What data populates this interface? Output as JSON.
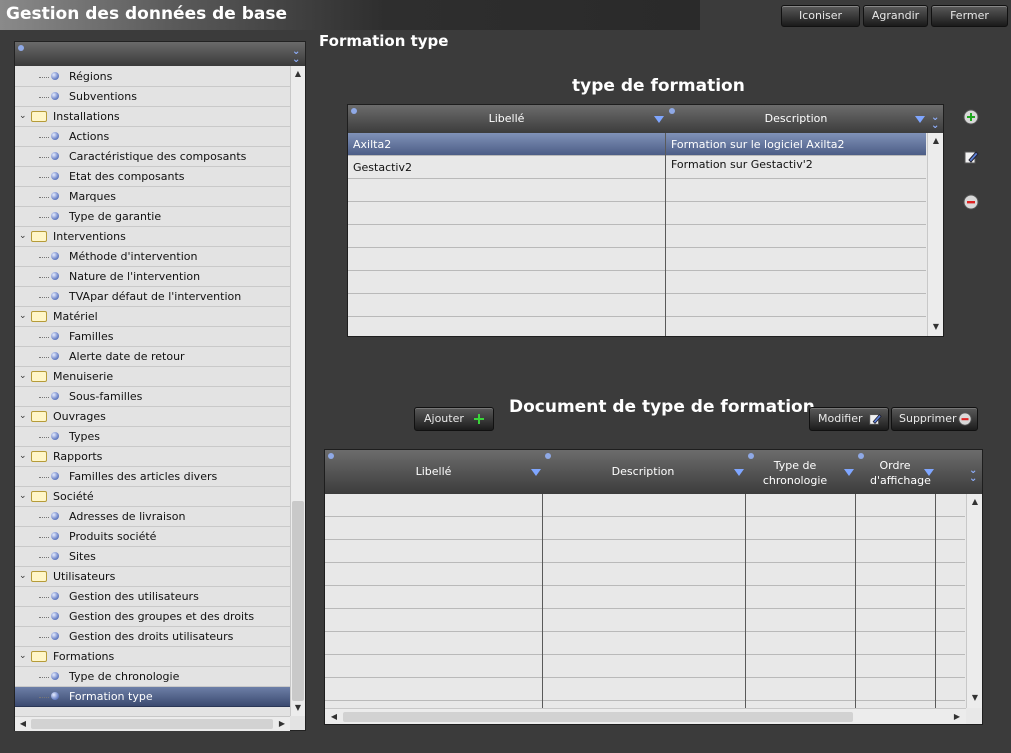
{
  "app": {
    "title": "Gestion des données de base"
  },
  "window_buttons": {
    "iconize": "Iconiser",
    "maximize": "Agrandir",
    "close": "Fermer"
  },
  "page": {
    "title": "Formation type"
  },
  "tree": [
    {
      "label": "Régions",
      "level": 1
    },
    {
      "label": "Subventions",
      "level": 1
    },
    {
      "label": "Installations",
      "level": 0
    },
    {
      "label": "Actions",
      "level": 1
    },
    {
      "label": "Caractéristique des composants",
      "level": 1
    },
    {
      "label": "Etat des composants",
      "level": 1
    },
    {
      "label": "Marques",
      "level": 1
    },
    {
      "label": "Type de garantie",
      "level": 1
    },
    {
      "label": "Interventions",
      "level": 0
    },
    {
      "label": "Méthode d'intervention",
      "level": 1
    },
    {
      "label": "Nature de l'intervention",
      "level": 1
    },
    {
      "label": "TVApar défaut de l'intervention",
      "level": 1
    },
    {
      "label": "Matériel",
      "level": 0
    },
    {
      "label": "Familles",
      "level": 1
    },
    {
      "label": "Alerte date de retour",
      "level": 1
    },
    {
      "label": "Menuiserie",
      "level": 0
    },
    {
      "label": "Sous-familles",
      "level": 1
    },
    {
      "label": "Ouvrages",
      "level": 0
    },
    {
      "label": "Types",
      "level": 1
    },
    {
      "label": "Rapports",
      "level": 0
    },
    {
      "label": "Familles des articles divers",
      "level": 1
    },
    {
      "label": "Société",
      "level": 0
    },
    {
      "label": "Adresses de livraison",
      "level": 1
    },
    {
      "label": "Produits société",
      "level": 1
    },
    {
      "label": "Sites",
      "level": 1
    },
    {
      "label": "Utilisateurs",
      "level": 0
    },
    {
      "label": "Gestion des utilisateurs",
      "level": 1
    },
    {
      "label": "Gestion des groupes et des droits",
      "level": 1
    },
    {
      "label": "Gestion des droits utilisateurs",
      "level": 1
    },
    {
      "label": "Formations",
      "level": 0
    },
    {
      "label": "Type de chronologie",
      "level": 1
    },
    {
      "label": "Formation type",
      "level": 1,
      "selected": true
    }
  ],
  "type_section": {
    "title": "type de formation",
    "columns": [
      "Libellé",
      "Description"
    ],
    "rows": [
      {
        "libelle": "Axilta2",
        "description": "Formation sur le logiciel Axilta2",
        "selected": true
      },
      {
        "libelle": "Gestactiv2",
        "description": "Formation sur Gestactiv'2"
      }
    ],
    "icons": [
      "add-icon",
      "edit-icon",
      "delete-icon"
    ]
  },
  "doc_section": {
    "title": "Document de type de formation",
    "add_label": "Ajouter",
    "modify_label": "Modifier",
    "delete_label": "Supprimer",
    "columns": [
      "Libellé",
      "Description",
      "Type de chronologie",
      "Ordre d'affichage"
    ]
  },
  "colors": {
    "selection": "#4c5d86",
    "accent_icon": "#7fa6ff",
    "background": "#3b3b3b"
  }
}
